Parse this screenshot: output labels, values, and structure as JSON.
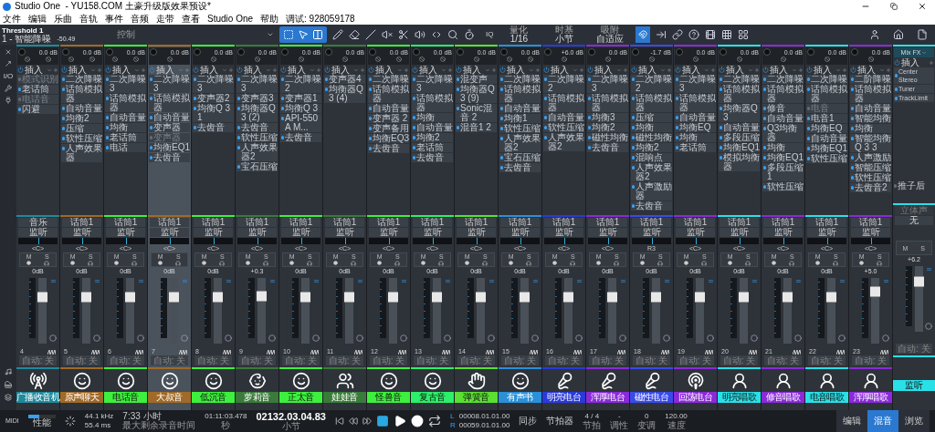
{
  "window": {
    "title": "Studio One  - YU158.COM 土豪升级版效果预设*"
  },
  "menu": [
    "文件",
    "编辑",
    "乐曲",
    "音轨",
    "事件",
    "音频",
    "走带",
    "查看",
    "Studio One",
    "帮助",
    "调试: 928059178"
  ],
  "toolbar": {
    "device": "Threshold 1",
    "track": "1 - 智能降噪",
    "value": "-50.49",
    "control": "控制",
    "iq": "IQ",
    "groups": [
      {
        "label": "量化",
        "value": "1/16"
      },
      {
        "label": "时基",
        "value": "小节"
      },
      {
        "label": "吸附",
        "value": "自适应"
      }
    ]
  },
  "sidebar": {
    "io": "I/O"
  },
  "channels": [
    {
      "number": "4",
      "name": "广播收音机",
      "color": "#1f8a9c",
      "kind": "radio",
      "selected": false,
      "gain": "0.0 dB",
      "stereo": true,
      "insert_label": "插入",
      "inserts": [
        {
          "name": "模式识别",
          "on": false
        },
        {
          "name": "老话筒",
          "on": true
        },
        {
          "name": "电话音",
          "on": false
        },
        {
          "name": "闪避",
          "on": true
        }
      ],
      "sends": [
        "音乐",
        "监听"
      ],
      "pan": "<C>",
      "mute": "M",
      "solo": "S",
      "volume": "0dB",
      "level": 0.75,
      "auto": "自动: 关"
    },
    {
      "number": "5",
      "name": "原声聊天",
      "color": "#a06a28",
      "kind": "smiley",
      "selected": false,
      "gain": "0.0 dB",
      "stereo": true,
      "insert_label": "插入",
      "inserts": [
        {
          "name": "二次降噪",
          "on": true
        },
        {
          "name": "话筒模拟器",
          "on": true
        },
        {
          "name": "自动音量",
          "on": true
        },
        {
          "name": "均衡2",
          "on": true
        },
        {
          "name": "压缩",
          "on": true
        },
        {
          "name": "软性压缩",
          "on": true
        },
        {
          "name": "人声效果器",
          "on": true
        }
      ],
      "sends": [
        "话筒1",
        "监听"
      ],
      "pan": "<C>",
      "mute": "M",
      "solo": "S",
      "volume": "0dB",
      "level": 0.75,
      "auto": "自动: 关"
    },
    {
      "number": "6",
      "name": "电话音",
      "color": "#3ef03e",
      "kind": "smiley",
      "selected": false,
      "gain": "0.0 dB",
      "stereo": true,
      "insert_label": "插入",
      "inserts": [
        {
          "name": "二次降噪 3",
          "on": true
        },
        {
          "name": "话筒模拟器",
          "on": true
        },
        {
          "name": "自动音量",
          "on": true
        },
        {
          "name": "均衡",
          "on": true
        },
        {
          "name": "老话筒",
          "on": true
        },
        {
          "name": "电话",
          "on": true
        }
      ],
      "sends": [
        "话筒1",
        "监听"
      ],
      "pan": "<C>",
      "mute": "M",
      "solo": "S",
      "volume": "0dB",
      "level": 0.75,
      "auto": "自动: 关"
    },
    {
      "number": "7",
      "name": "大叔音",
      "color": "#a06a28",
      "kind": "smiley",
      "selected": true,
      "gain": "0.0 dB",
      "stereo": false,
      "insert_label": "插入",
      "inserts": [
        {
          "name": "二次降噪 3",
          "on": true
        },
        {
          "name": "话筒模拟器",
          "on": true
        },
        {
          "name": "自动音量",
          "on": true
        },
        {
          "name": "变声器",
          "on": true
        },
        {
          "name": "变声器",
          "on": false
        },
        {
          "name": "均衡EQ1",
          "on": true
        },
        {
          "name": "去齿音",
          "on": true
        }
      ],
      "sends": [
        "话筒1",
        "监听"
      ],
      "pan": "<C>",
      "mute": "M",
      "solo": "S",
      "volume": "0dB",
      "level": 0.75,
      "auto": "自动: 关"
    },
    {
      "number": "8",
      "name": "低沉音",
      "color": "#3ef03e",
      "kind": "smiley",
      "selected": false,
      "gain": "0.0 dB",
      "stereo": false,
      "insert_label": "插入",
      "inserts": [
        {
          "name": "二次降噪 3",
          "on": true
        },
        {
          "name": "变声器2",
          "on": true
        },
        {
          "name": "均衡Q 3 1",
          "on": true
        },
        {
          "name": "去齿音",
          "on": true
        }
      ],
      "sends": [
        "话筒1",
        "监听"
      ],
      "pan": "<C>",
      "mute": "M",
      "solo": "S",
      "volume": "0dB",
      "level": 0.75,
      "auto": "自动: 关"
    },
    {
      "number": "9",
      "name": "萝莉音",
      "color": "#3a7a3a",
      "kind": "child",
      "selected": false,
      "gain": "0.0 dB",
      "stereo": false,
      "insert_label": "插入",
      "inserts": [
        {
          "name": "二次降噪 3",
          "on": true
        },
        {
          "name": "变声器3",
          "on": true
        },
        {
          "name": "均衡器Q 3 (2)",
          "on": true
        },
        {
          "name": "去齿音",
          "on": true
        },
        {
          "name": "软性压缩",
          "on": true
        },
        {
          "name": "人声效果器2",
          "on": true
        },
        {
          "name": "宝石压缩",
          "on": true
        }
      ],
      "sends": [
        "话筒1",
        "监听"
      ],
      "pan": "<C>",
      "mute": "M",
      "solo": "S",
      "volume": "+0.3",
      "level": 0.77,
      "auto": "自动: 关"
    },
    {
      "number": "10",
      "name": "正太音",
      "color": "#3ef03e",
      "kind": "smiley",
      "selected": false,
      "gain": "0.0 dB",
      "stereo": false,
      "insert_label": "插入",
      "inserts": [
        {
          "name": "二次降噪 2",
          "on": true
        },
        {
          "name": "变声器1",
          "on": true
        },
        {
          "name": "均衡Q 3",
          "on": true
        },
        {
          "name": "API-550A M...",
          "on": true
        },
        {
          "name": "去齿音",
          "on": true
        }
      ],
      "sends": [
        "话筒1",
        "监听"
      ],
      "pan": "<C>",
      "mute": "M",
      "solo": "S",
      "volume": "0dB",
      "level": 0.75,
      "auto": "自动: 关"
    },
    {
      "number": "11",
      "name": "娃娃音",
      "color": "#3a7a3a",
      "kind": "group",
      "selected": false,
      "gain": "0.0 dB",
      "stereo": false,
      "insert_label": "插入",
      "inserts": [
        {
          "name": "变声器4",
          "on": true
        },
        {
          "name": "均衡器Q 3 (4)",
          "on": true
        }
      ],
      "sends": [
        "话筒1",
        "监听"
      ],
      "pan": "<C>",
      "mute": "M",
      "solo": "S",
      "volume": "0dB",
      "level": 0.75,
      "auto": "自动: 关"
    },
    {
      "number": "12",
      "name": "怪兽音",
      "color": "#3ef03e",
      "kind": "smiley",
      "selected": false,
      "gain": "0.0 dB",
      "stereo": true,
      "insert_label": "插入",
      "inserts": [
        {
          "name": "二次降噪",
          "on": true
        },
        {
          "name": "话筒模拟器",
          "on": true
        },
        {
          "name": "自动音量",
          "on": true
        },
        {
          "name": "变声器 2",
          "on": true
        },
        {
          "name": "变声备用",
          "on": true
        },
        {
          "name": "均衡EQ3",
          "on": true
        },
        {
          "name": "去齿音",
          "on": true
        }
      ],
      "sends": [
        "话筒1",
        "监听"
      ],
      "pan": "<C>",
      "mute": "M",
      "solo": "S",
      "volume": "0dB",
      "level": 0.75,
      "auto": "自动: 关"
    },
    {
      "number": "13",
      "name": "复古音",
      "color": "#2cf06a",
      "kind": "smiley",
      "selected": false,
      "gain": "0.0 dB",
      "stereo": true,
      "insert_label": "插入",
      "inserts": [
        {
          "name": "二次降噪 3",
          "on": true
        },
        {
          "name": "话筒模拟器",
          "on": true
        },
        {
          "name": "均衡",
          "on": true
        },
        {
          "name": "自动音量",
          "on": true
        },
        {
          "name": "均衡2",
          "on": true
        },
        {
          "name": "老话筒",
          "on": true
        },
        {
          "name": "去齿音",
          "on": true
        }
      ],
      "sends": [
        "话筒1",
        "监听"
      ],
      "pan": "<C>",
      "mute": "M",
      "solo": "S",
      "volume": "0dB",
      "level": 0.75,
      "auto": "自动: 关"
    },
    {
      "number": "14",
      "name": "弹簧音",
      "color": "#5ae032",
      "kind": "clap",
      "selected": false,
      "gain": "0.0 dB",
      "stereo": false,
      "insert_label": "插入",
      "inserts": [
        {
          "name": "混变声",
          "on": true
        },
        {
          "name": "均衡器Q 3 (9)",
          "on": true
        },
        {
          "name": "Sonic混音 2",
          "on": true
        },
        {
          "name": "混音1 2",
          "on": true
        }
      ],
      "sends": [
        "话筒1",
        "监听"
      ],
      "pan": "<C>",
      "mute": "M",
      "solo": "S",
      "volume": "0dB",
      "level": 0.75,
      "auto": "自动: 关"
    },
    {
      "number": "15",
      "name": "有声书",
      "color": "#2a90d8",
      "kind": "smiley",
      "selected": false,
      "gain": "0.0 dB",
      "stereo": true,
      "insert_label": "插入",
      "inserts": [
        {
          "name": "二次降噪",
          "on": true
        },
        {
          "name": "话筒模拟器",
          "on": true
        },
        {
          "name": "自动音量",
          "on": true
        },
        {
          "name": "均衡1",
          "on": true
        },
        {
          "name": "软性压缩",
          "on": true
        },
        {
          "name": "人声效果器2",
          "on": true
        },
        {
          "name": "宝石压缩",
          "on": true
        },
        {
          "name": "去齿音",
          "on": true
        }
      ],
      "sends": [
        "话筒1",
        "监听"
      ],
      "pan": "<C>",
      "mute": "M",
      "solo": "S",
      "volume": "0dB",
      "level": 0.75,
      "auto": "自动: 关"
    },
    {
      "number": "16",
      "name": "明亮电台",
      "color": "#2a3ad8",
      "kind": "mic",
      "selected": false,
      "gain": "+6.0 dB",
      "stereo": false,
      "insert_label": "插入",
      "inserts": [
        {
          "name": "二次降噪 2",
          "on": true
        },
        {
          "name": "话筒模拟器",
          "on": true
        },
        {
          "name": "自动音量",
          "on": true
        },
        {
          "name": "软性压缩",
          "on": true
        },
        {
          "name": "人声效果器2",
          "on": true
        }
      ],
      "sends": [
        "话筒1",
        "监听"
      ],
      "pan": "<C>",
      "mute": "M",
      "solo": "S",
      "volume": "0dB",
      "level": 0.75,
      "auto": "自动: 关"
    },
    {
      "number": "17",
      "name": "浑厚电台",
      "color": "#8a2ad8",
      "kind": "mic",
      "selected": false,
      "gain": "0.0 dB",
      "stereo": false,
      "insert_label": "插入",
      "inserts": [
        {
          "name": "二次降噪 3",
          "on": true
        },
        {
          "name": "话筒模拟器",
          "on": true
        },
        {
          "name": "均衡3",
          "on": true
        },
        {
          "name": "均衡2",
          "on": true
        },
        {
          "name": "磁性均衡",
          "on": true
        },
        {
          "name": "去齿音",
          "on": true
        }
      ],
      "sends": [
        "话筒1",
        "监听"
      ],
      "pan": "<C>",
      "mute": "M",
      "solo": "S",
      "volume": "0dB",
      "level": 0.75,
      "auto": "自动: 关"
    },
    {
      "number": "18",
      "name": "磁性电台",
      "color": "#3a4ae8",
      "kind": "mic",
      "selected": false,
      "gain": "-1.7 dB",
      "stereo": false,
      "insert_label": "插入",
      "inserts": [
        {
          "name": "二次降噪 2",
          "on": true
        },
        {
          "name": "话筒模拟器",
          "on": true
        },
        {
          "name": "压缩",
          "on": true
        },
        {
          "name": "均衡",
          "on": true
        },
        {
          "name": "磁性均衡",
          "on": true
        },
        {
          "name": "均衡2",
          "on": true
        },
        {
          "name": "混响点",
          "on": true
        },
        {
          "name": "人声效果器2",
          "on": true
        },
        {
          "name": "人声激励器",
          "on": true
        },
        {
          "name": "去齿音",
          "on": true
        }
      ],
      "sends": [
        "话筒1",
        "监听"
      ],
      "pan": "R3",
      "mute": "M",
      "solo": "S",
      "volume": "0dB",
      "level": 0.75,
      "auto": "自动: 关"
    },
    {
      "number": "19",
      "name": "回荡电台",
      "color": "#8a2ad8",
      "kind": "broadcast",
      "selected": false,
      "gain": "0.0 dB",
      "stereo": false,
      "insert_label": "插入",
      "inserts": [
        {
          "name": "二次降噪 3",
          "on": true
        },
        {
          "name": "话筒模拟器",
          "on": true
        },
        {
          "name": "自动音量",
          "on": true
        },
        {
          "name": "均衡EQ",
          "on": true
        },
        {
          "name": "均衡",
          "on": true
        },
        {
          "name": "老话筒",
          "on": true
        }
      ],
      "sends": [
        "话筒1",
        "监听"
      ],
      "pan": "<C>",
      "mute": "M",
      "solo": "S",
      "volume": "0dB",
      "level": 0.75,
      "auto": "自动: 关"
    },
    {
      "number": "20",
      "name": "明亮唱歌",
      "color": "#2ae0e8",
      "kind": "singer",
      "selected": false,
      "gain": "0.0 dB",
      "stereo": false,
      "insert_label": "插入",
      "inserts": [
        {
          "name": "二次降噪",
          "on": true
        },
        {
          "name": "话筒模拟器",
          "on": true
        },
        {
          "name": "均衡器Q3",
          "on": true
        },
        {
          "name": "自动音量",
          "on": true
        },
        {
          "name": "多段压缩",
          "on": true
        },
        {
          "name": "均衡EQ1",
          "on": true
        },
        {
          "name": "模拟均衡器",
          "on": true
        }
      ],
      "sends": [
        "话筒1",
        "监听"
      ],
      "pan": "<C>",
      "mute": "M",
      "solo": "S",
      "volume": "0dB",
      "level": 0.75,
      "auto": "自动: 关"
    },
    {
      "number": "21",
      "name": "修音唱歌",
      "color": "#8a2ad8",
      "kind": "singer",
      "selected": false,
      "gain": "0.0 dB",
      "stereo": false,
      "insert_label": "插入",
      "inserts": [
        {
          "name": "二次降噪",
          "on": true
        },
        {
          "name": "话筒模拟器",
          "on": true
        },
        {
          "name": "修音",
          "on": true
        },
        {
          "name": "自动音量",
          "on": true
        },
        {
          "name": "Q3均衡器",
          "on": true
        },
        {
          "name": "均衡",
          "on": true
        },
        {
          "name": "均衡EQ1",
          "on": true
        },
        {
          "name": "多段压缩1",
          "on": true
        },
        {
          "name": "软性压缩",
          "on": true
        }
      ],
      "sends": [
        "话筒1",
        "监听"
      ],
      "pan": "<C>",
      "mute": "M",
      "solo": "S",
      "volume": "0dB",
      "level": 0.75,
      "auto": "自动: 关"
    },
    {
      "number": "22",
      "name": "电音唱歌",
      "color": "#2ae0e8",
      "kind": "singer",
      "selected": false,
      "gain": "0.0 dB",
      "stereo": false,
      "insert_label": "插入",
      "inserts": [
        {
          "name": "二次降噪",
          "on": true
        },
        {
          "name": "话筒模拟器",
          "on": true
        },
        {
          "name": "电音",
          "on": false
        },
        {
          "name": "电音1",
          "on": true
        },
        {
          "name": "均衡EQ",
          "on": true
        },
        {
          "name": "自动音量",
          "on": true
        },
        {
          "name": "均衡EQ1",
          "on": true
        },
        {
          "name": "软性压缩",
          "on": true
        }
      ],
      "sends": [
        "话筒1",
        "监听"
      ],
      "pan": "<C>",
      "mute": "M",
      "solo": "S",
      "volume": "0dB",
      "level": 0.75,
      "auto": "自动: 关"
    },
    {
      "number": "23",
      "name": "浑厚唱歌",
      "color": "#8a2ad8",
      "kind": "singer",
      "selected": false,
      "gain": "0.0 dB",
      "stereo": false,
      "insert_label": "插入",
      "inserts": [
        {
          "name": "二阶降噪",
          "on": true
        },
        {
          "name": "话筒模拟器",
          "on": true
        },
        {
          "name": "自动音量",
          "on": true
        },
        {
          "name": "智能均衡",
          "on": true
        },
        {
          "name": "均衡",
          "on": true
        },
        {
          "name": "智能均衡Q 3 3",
          "on": true
        },
        {
          "name": "人声激励",
          "on": true
        },
        {
          "name": "智能压缩",
          "on": true
        },
        {
          "name": "软性压缩",
          "on": true
        },
        {
          "name": "去齿音2",
          "on": true
        }
      ],
      "sends": [
        "话筒1",
        "监听"
      ],
      "pan": "<C>",
      "mute": "M",
      "solo": "S",
      "volume": "+5.0",
      "level": 0.85,
      "auto": "自动: 关"
    }
  ],
  "main": {
    "title": "Mix FX",
    "insert_label": "插入",
    "inserts": [
      {
        "name": "Center Stereo",
        "on": true
      },
      {
        "name": "Tuner",
        "on": true
      },
      {
        "name": "TrackLimit",
        "on": true
      }
    ],
    "post_label": "推子后",
    "post_on": false,
    "input": "立体声",
    "output": "无",
    "mute": "M",
    "solo": "S",
    "volume": "+6.2",
    "level": 0.82,
    "auto": "自动: 关",
    "name": "监听",
    "color": "#2ae0e8"
  },
  "transport": {
    "midi": "MIDI",
    "performance": "性能",
    "sample_rate": "44.1 kHz",
    "latency": "55.4 ms",
    "record_time": "7:33 小时",
    "record_time_label": "最大剩余录音时间",
    "seconds": "01:11:03.478",
    "seconds_label": "秒",
    "bars": "02132.03.04.83",
    "bars_label": "小节",
    "loop_left": "L",
    "loop_left_value": "00008.01.01.00",
    "loop_right": "R",
    "loop_right_value": "00059.01.01.00",
    "sync": "同步",
    "metronome": "节拍器",
    "signature": "4 / 4",
    "signature_label": "节拍",
    "key": "-",
    "key_label": "调性",
    "transpose": "0",
    "transpose_label": "变调",
    "tempo": "120.00",
    "tempo_label": "速度"
  },
  "views": [
    {
      "label": "编辑",
      "selected": false
    },
    {
      "label": "混音",
      "selected": true
    },
    {
      "label": "浏览",
      "selected": false
    }
  ]
}
